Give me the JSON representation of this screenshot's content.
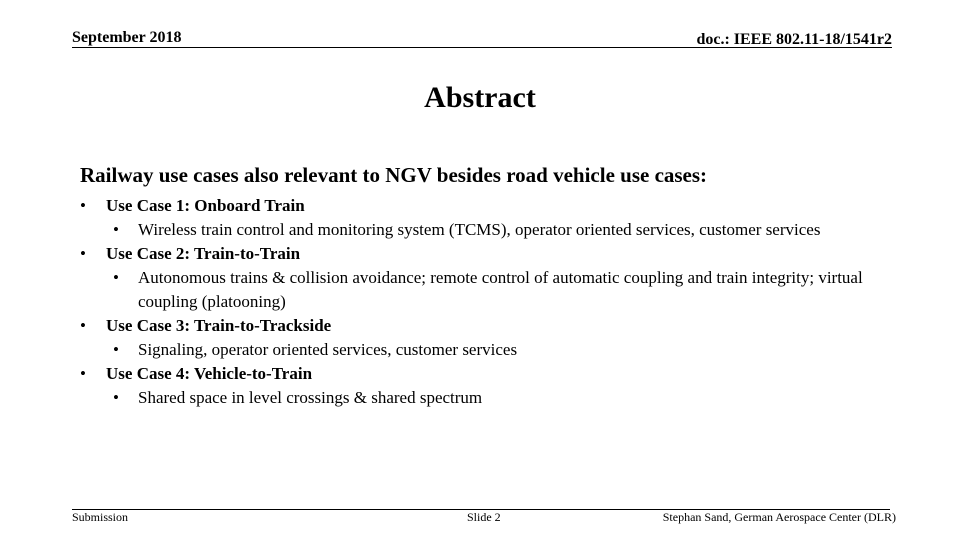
{
  "header": {
    "date": "September 2018",
    "doc_id": "doc.: IEEE 802.11-18/1541r2"
  },
  "slide": {
    "title": "Abstract",
    "lead": "Railway use cases also relevant to NGV besides road vehicle use cases:",
    "bullet_glyph": "•",
    "use_cases": [
      {
        "label": "Use Case 1: Onboard Train",
        "details": [
          "Wireless train control and monitoring system (TCMS), operator oriented services, customer services"
        ]
      },
      {
        "label": "Use Case 2: Train-to-Train",
        "details": [
          "Autonomous trains & collision avoidance; remote control of automatic coupling and train integrity; virtual coupling (platooning)"
        ]
      },
      {
        "label": "Use Case 3: Train-to-Trackside",
        "details": [
          "Signaling, operator oriented services, customer services"
        ]
      },
      {
        "label": "Use Case 4: Vehicle-to-Train",
        "details": [
          "Shared space in level crossings & shared spectrum"
        ]
      }
    ]
  },
  "footer": {
    "left": "Submission",
    "center": "Slide 2",
    "right": "Stephan Sand, German Aerospace Center (DLR)"
  }
}
